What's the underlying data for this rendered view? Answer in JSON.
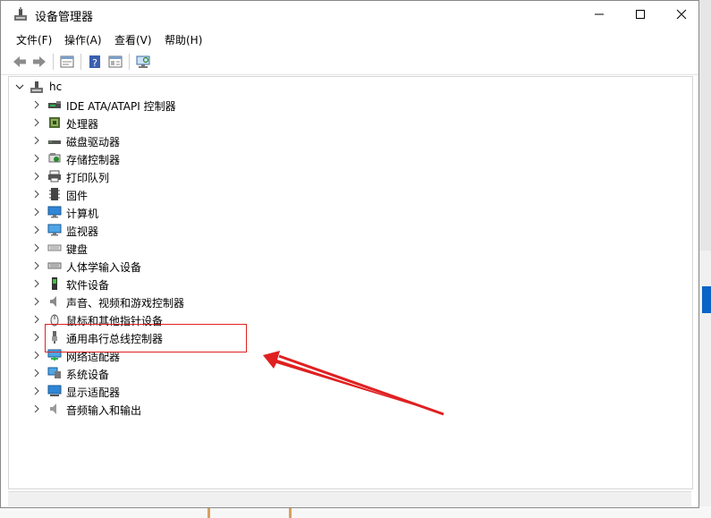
{
  "window": {
    "title": "设备管理器"
  },
  "menu": [
    "文件(F)",
    "操作(A)",
    "查看(V)",
    "帮助(H)"
  ],
  "toolbar": {
    "icons": [
      "back-arrow-icon",
      "forward-arrow-icon",
      "properties-icon",
      "help-icon",
      "view-icon",
      "monitor-scan-icon"
    ]
  },
  "tree": {
    "root": "hc",
    "items": [
      "IDE ATA/ATAPI 控制器",
      "处理器",
      "磁盘驱动器",
      "存储控制器",
      "打印队列",
      "固件",
      "计算机",
      "监视器",
      "键盘",
      "人体学输入设备",
      "软件设备",
      "声音、视频和游戏控制器",
      "鼠标和其他指针设备",
      "通用串行总线控制器",
      "网络适配器",
      "系统设备",
      "显示适配器",
      "音频输入和输出"
    ]
  },
  "annotation": {
    "color": "#e02020",
    "highlighted_item": "通用串行总线控制器"
  }
}
